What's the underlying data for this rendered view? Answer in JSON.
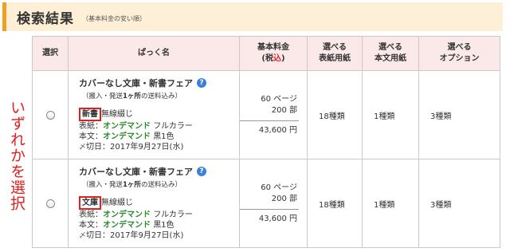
{
  "header": {
    "title": "検索結果",
    "subtitle": "（基本料金の安い順）"
  },
  "side_note": "いずれかを選択",
  "table": {
    "columns": {
      "select": "選択",
      "pack_name": "ぱっく名",
      "base_price_line1": "基本料金",
      "base_price_line2_open": "(税",
      "base_price_line2_red": "込",
      "base_price_line2_close": ")",
      "cover_paper_line1": "選べる",
      "cover_paper_line2": "表紙用紙",
      "body_paper_line1": "選べる",
      "body_paper_line2": "本文用紙",
      "options_line1": "選べる",
      "options_line2": "オプション"
    },
    "rows": [
      {
        "name": "カバーなし文庫・新書フェア",
        "help": "?",
        "note_open": "（搬入・発送",
        "note_bold": "1ヶ所",
        "note_close": "の送料込み）",
        "format": "新書",
        "binding": "無線綴じ",
        "cover_label": "表紙：",
        "cover_method": "オンデマンド",
        "cover_color": "フルカラー",
        "body_label": "本文：",
        "body_method": "オンデマンド",
        "body_color": "黒1色",
        "deadline_icon": "〆",
        "deadline": "切日：2017年9月27日(水)",
        "pages": "60 ページ",
        "copies": "200 部",
        "price": "43,600 円",
        "cover_paper": "18種類",
        "body_paper": "1種類",
        "options": "3種類"
      },
      {
        "name": "カバーなし文庫・新書フェア",
        "help": "?",
        "note_open": "（搬入・発送",
        "note_bold": "1ヶ所",
        "note_close": "の送料込み）",
        "format": "文庫",
        "binding": "無線綴じ",
        "cover_label": "表紙：",
        "cover_method": "オンデマンド",
        "cover_color": "フルカラー",
        "body_label": "本文：",
        "body_method": "オンデマンド",
        "body_color": "黒1色",
        "deadline_icon": "〆",
        "deadline": "切日：2017年9月27日(水)",
        "pages": "60 ページ",
        "copies": "200 部",
        "price": "43,600 円",
        "cover_paper": "18種類",
        "body_paper": "1種類",
        "options": "3種類"
      }
    ]
  },
  "colors": {
    "header_bg": "#fdf0d6",
    "header_accent": "#f0a020",
    "table_head_bg": "#fbe9ea",
    "highlight_red": "#e02020",
    "ondemand_green": "#2a8a2a",
    "help_blue": "#3b82d6"
  }
}
